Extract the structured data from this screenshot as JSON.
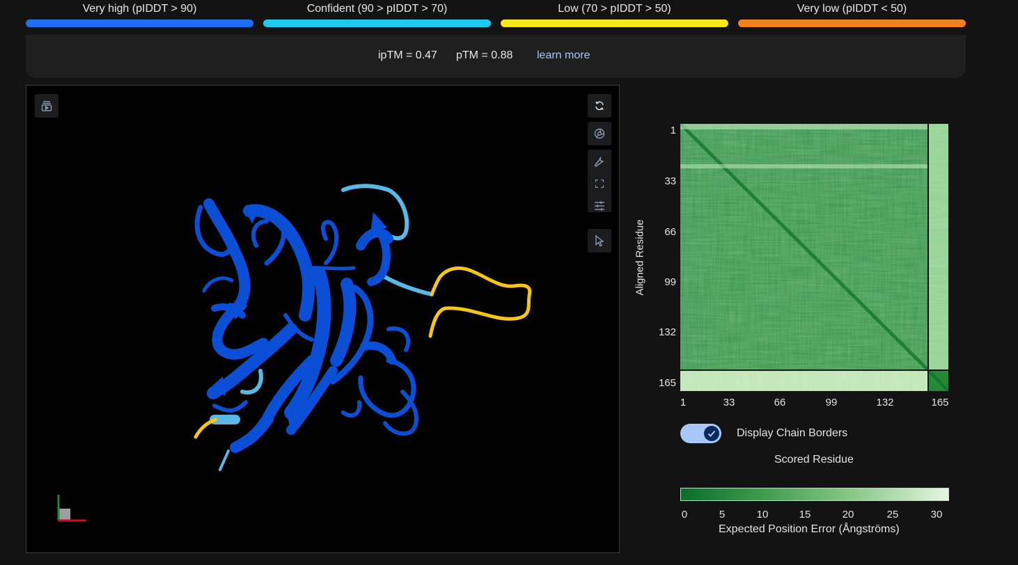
{
  "legend": [
    {
      "label": "Very high (pIDDT > 90)",
      "color": "#1f6ef5"
    },
    {
      "label": "Confident (90 > pIDDT > 70)",
      "color": "#1ecbf0"
    },
    {
      "label": "Low (70 > pIDDT > 50)",
      "color": "#f7e817"
    },
    {
      "label": "Very low (pIDDT < 50)",
      "color": "#f2821f"
    }
  ],
  "metrics": {
    "iptm": "ipTM = 0.47",
    "ptm": "pTM = 0.88",
    "learn_more": "learn more"
  },
  "viewer": {
    "tools": [
      "play-layers-icon",
      "rotate-icon",
      "camera-icon",
      "wrench-icon",
      "fullscreen-icon",
      "sliders-icon",
      "pointer-icon"
    ],
    "colors": {
      "very_high": "#0b4fd6",
      "confident": "#5ab8e6",
      "low": "#f5c518"
    }
  },
  "pae": {
    "y_axis_label": "Aligned Residue",
    "x_axis_label": "Scored Residue",
    "y_ticks": [
      "1",
      "33",
      "66",
      "99",
      "132",
      "165"
    ],
    "x_ticks": [
      "1",
      "33",
      "66",
      "99",
      "132",
      "165"
    ],
    "toggle_label": "Display Chain Borders",
    "toggle_on": true,
    "colorbar_ticks": [
      "0",
      "5",
      "10",
      "15",
      "20",
      "25",
      "30"
    ],
    "colorbar_label": "Expected Position Error (Ångströms)",
    "color_low": "#0c6e2c",
    "color_high": "#e6f5e0"
  }
}
